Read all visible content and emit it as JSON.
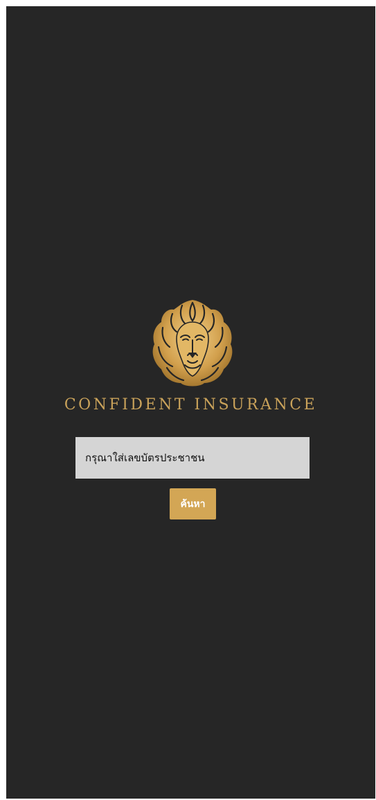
{
  "brand": {
    "logo_icon": "lion-head-icon",
    "name": "CONFIDENT INSURANCE",
    "color": "#c9a25a"
  },
  "search": {
    "placeholder": "กรุณาใส่เลขบัตรประชาชน",
    "value": "",
    "button_label": "ค้นหา",
    "button_color": "#d3a655"
  },
  "colors": {
    "background": "#262626",
    "input_background": "#d5d5d5"
  }
}
